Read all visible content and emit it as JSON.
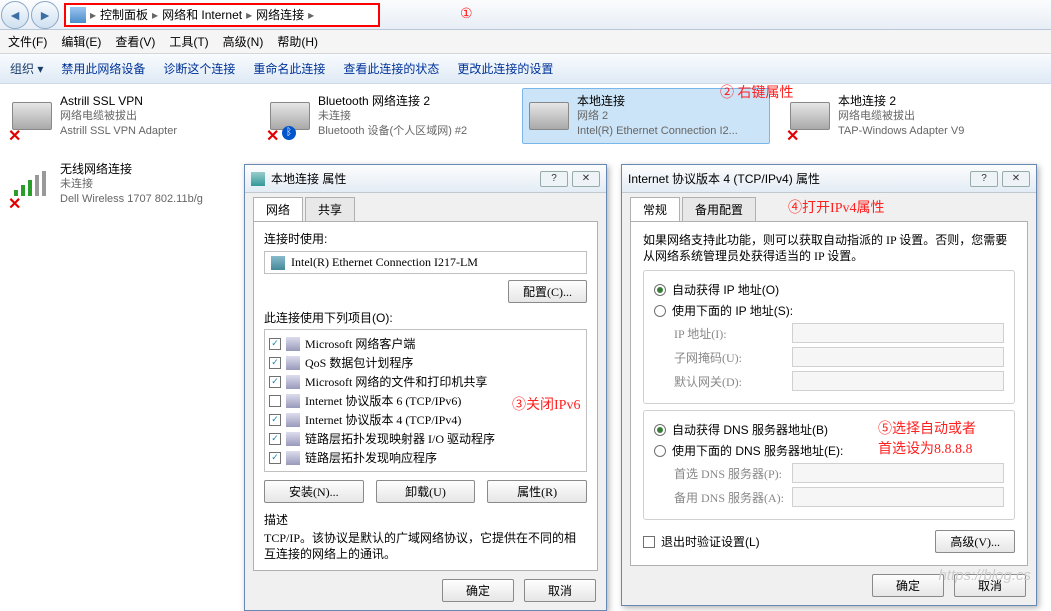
{
  "breadcrumb": {
    "items": [
      "控制面板",
      "网络和 Internet",
      "网络连接"
    ]
  },
  "menu": [
    "文件(F)",
    "编辑(E)",
    "查看(V)",
    "工具(T)",
    "高级(N)",
    "帮助(H)"
  ],
  "toolbar": [
    "组织 ▾",
    "禁用此网络设备",
    "诊断这个连接",
    "重命名此连接",
    "查看此连接的状态",
    "更改此连接的设置"
  ],
  "annot": {
    "a1": "①",
    "a2": "② 右键属性",
    "a3": "③关闭IPv6",
    "a4": "④打开IPv4属性",
    "a5": "⑤选择自动或者",
    "a5b": "首选设为8.8.8.8"
  },
  "conns": [
    {
      "name": "Astrill SSL VPN",
      "sub": "网络电缆被拔出",
      "adapter": "Astrill SSL VPN Adapter",
      "x": true
    },
    {
      "name": "Bluetooth 网络连接 2",
      "sub": "未连接",
      "adapter": "Bluetooth 设备(个人区域网) #2",
      "x": true,
      "bt": true
    },
    {
      "name": "本地连接",
      "sub": "网络 2",
      "adapter": "Intel(R) Ethernet Connection I2...",
      "sel": true
    },
    {
      "name": "本地连接 2",
      "sub": "网络电缆被拔出",
      "adapter": "TAP-Windows Adapter V9",
      "x": true
    }
  ],
  "wifi": {
    "name": "无线网络连接",
    "sub": "未连接",
    "adapter": "Dell Wireless 1707 802.11b/g"
  },
  "dlg1": {
    "title": "本地连接 属性",
    "tabs": [
      "网络",
      "共享"
    ],
    "connect_label": "连接时使用:",
    "adapter": "Intel(R) Ethernet Connection I217-LM",
    "configure": "配置(C)...",
    "items_label": "此连接使用下列项目(O):",
    "items": [
      {
        "c": true,
        "t": "Microsoft 网络客户端"
      },
      {
        "c": true,
        "t": "QoS 数据包计划程序"
      },
      {
        "c": true,
        "t": "Microsoft 网络的文件和打印机共享"
      },
      {
        "c": false,
        "t": "Internet 协议版本 6 (TCP/IPv6)"
      },
      {
        "c": true,
        "t": "Internet 协议版本 4 (TCP/IPv4)"
      },
      {
        "c": true,
        "t": "链路层拓扑发现映射器 I/O 驱动程序"
      },
      {
        "c": true,
        "t": "链路层拓扑发现响应程序"
      }
    ],
    "install": "安装(N)...",
    "uninstall": "卸载(U)",
    "props": "属性(R)",
    "desc_lbl": "描述",
    "desc": "TCP/IP。该协议是默认的广域网络协议，它提供在不同的相互连接的网络上的通讯。",
    "ok": "确定",
    "cancel": "取消"
  },
  "dlg2": {
    "title": "Internet 协议版本 4 (TCP/IPv4) 属性",
    "tabs": [
      "常规",
      "备用配置"
    ],
    "intro": "如果网络支持此功能，则可以获取自动指派的 IP 设置。否则，您需要从网络系统管理员处获得适当的 IP 设置。",
    "r1": "自动获得 IP 地址(O)",
    "r2": "使用下面的 IP 地址(S):",
    "ip": "IP 地址(I):",
    "mask": "子网掩码(U):",
    "gw": "默认网关(D):",
    "r3": "自动获得 DNS 服务器地址(B)",
    "r4": "使用下面的 DNS 服务器地址(E):",
    "dns1": "首选 DNS 服务器(P):",
    "dns2": "备用 DNS 服务器(A):",
    "exit_chk": "退出时验证设置(L)",
    "adv": "高级(V)...",
    "ok": "确定",
    "cancel": "取消"
  },
  "watermark": "https://blog.cs"
}
